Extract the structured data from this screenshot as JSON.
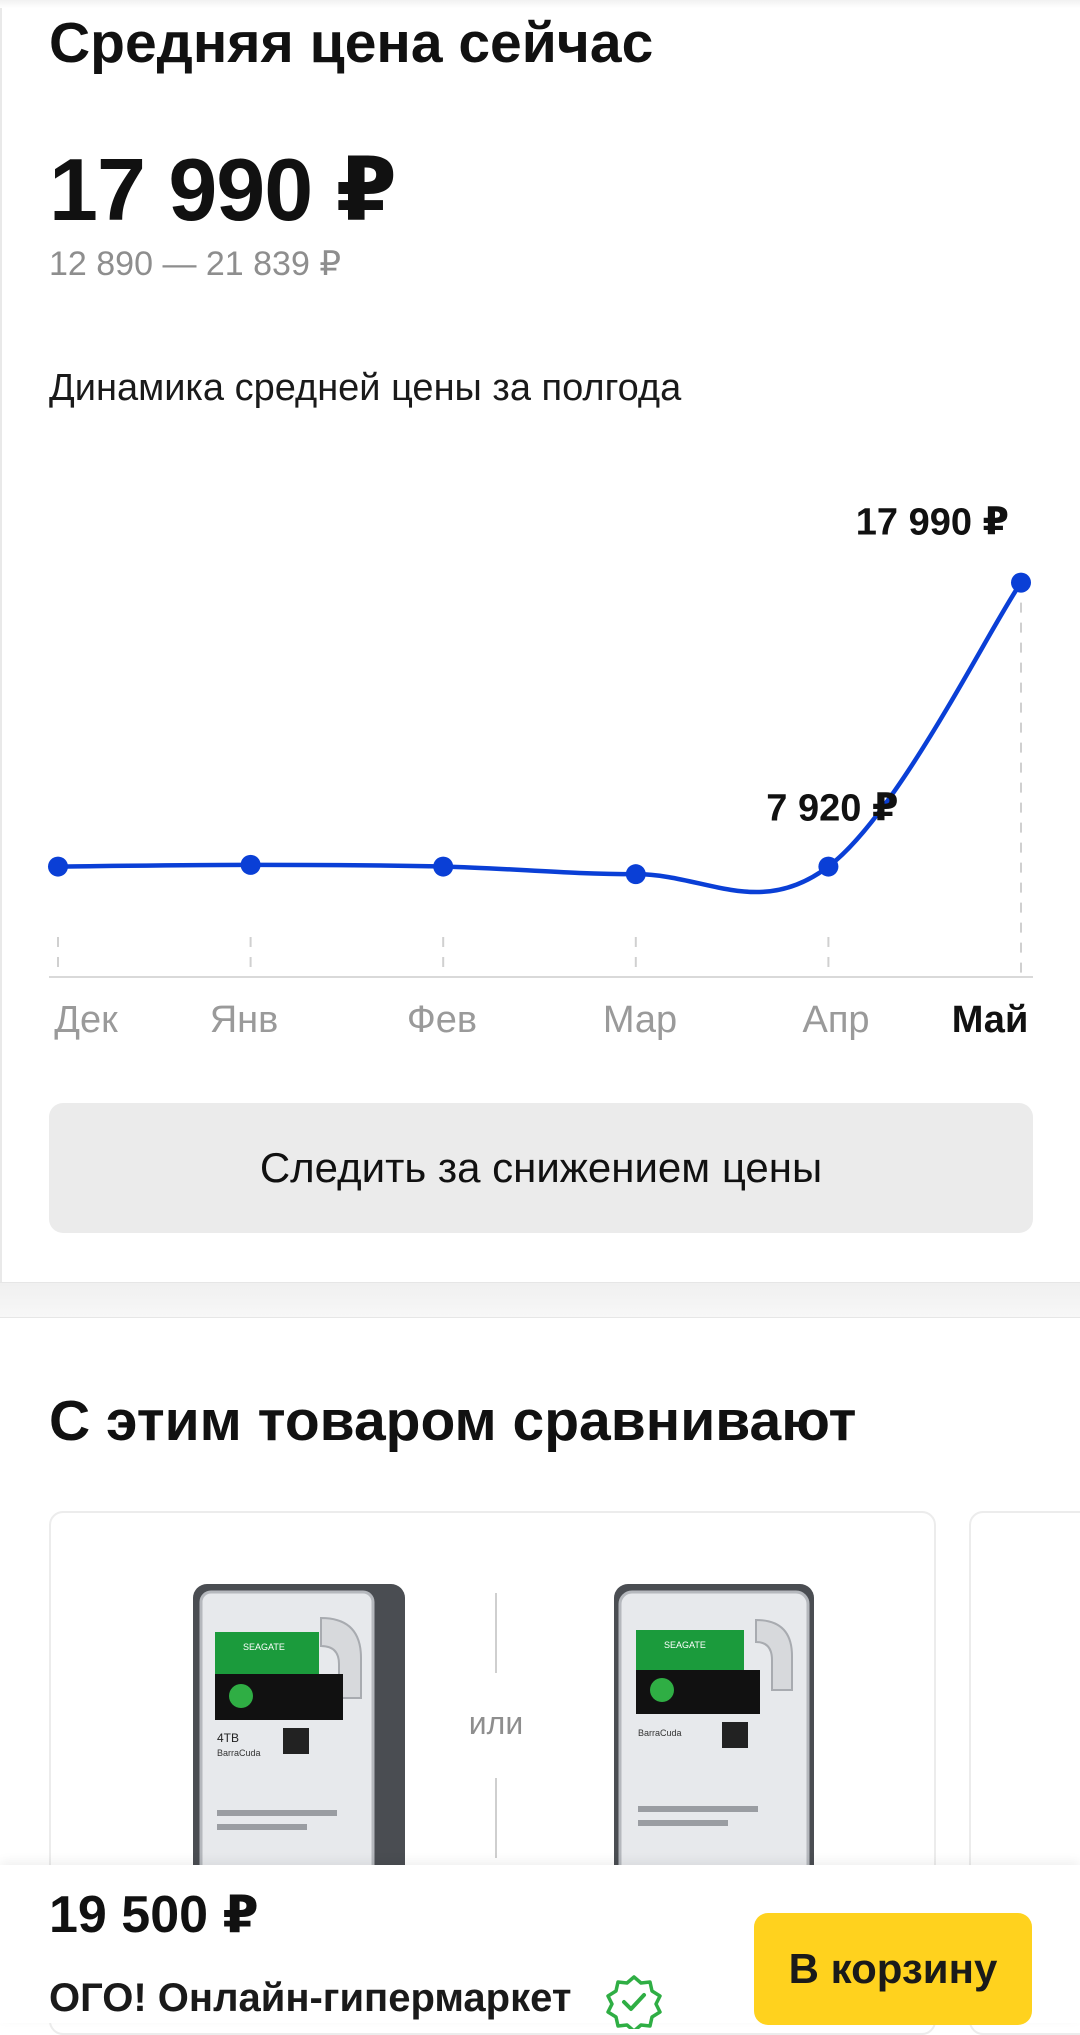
{
  "avg_section": {
    "title": "Средняя цена сейчас",
    "current_price": "17 990 ₽",
    "price_range": "12 890 — 21 839 ₽",
    "chart_caption": "Динамика средней цены за полгода"
  },
  "chart_data": {
    "type": "line",
    "categories": [
      "Дек",
      "Янв",
      "Фев",
      "Мар",
      "Апр",
      "Май"
    ],
    "active_category": "Май",
    "values": [
      7920,
      7980,
      7920,
      7650,
      7920,
      17990
    ],
    "point_labels": [
      {
        "index": 4,
        "text": "7 920 ₽"
      },
      {
        "index": 5,
        "text": "17 990 ₽"
      }
    ],
    "ylim": [
      5600,
      19500
    ],
    "line_color": "#0a3fd6",
    "grid": false
  },
  "track_button": {
    "label": "Следить за снижением цены"
  },
  "compare_section": {
    "title": "С этим товаром сравнивают",
    "or_label": "или",
    "left_product": {
      "drive_brand": "SEAGATE",
      "model": "BarraCuda",
      "capacity": "4TB"
    },
    "right_product": {
      "drive_brand": "SEAGATE",
      "model": "BarraCuda"
    }
  },
  "bottom_bar": {
    "offer_price": "19 500 ₽",
    "shop_name": "ОГО! Онлайн-гипермаркет",
    "cart_button": "В корзину",
    "accent_color": "#ffd21e",
    "verified_color": "#2fae44"
  }
}
